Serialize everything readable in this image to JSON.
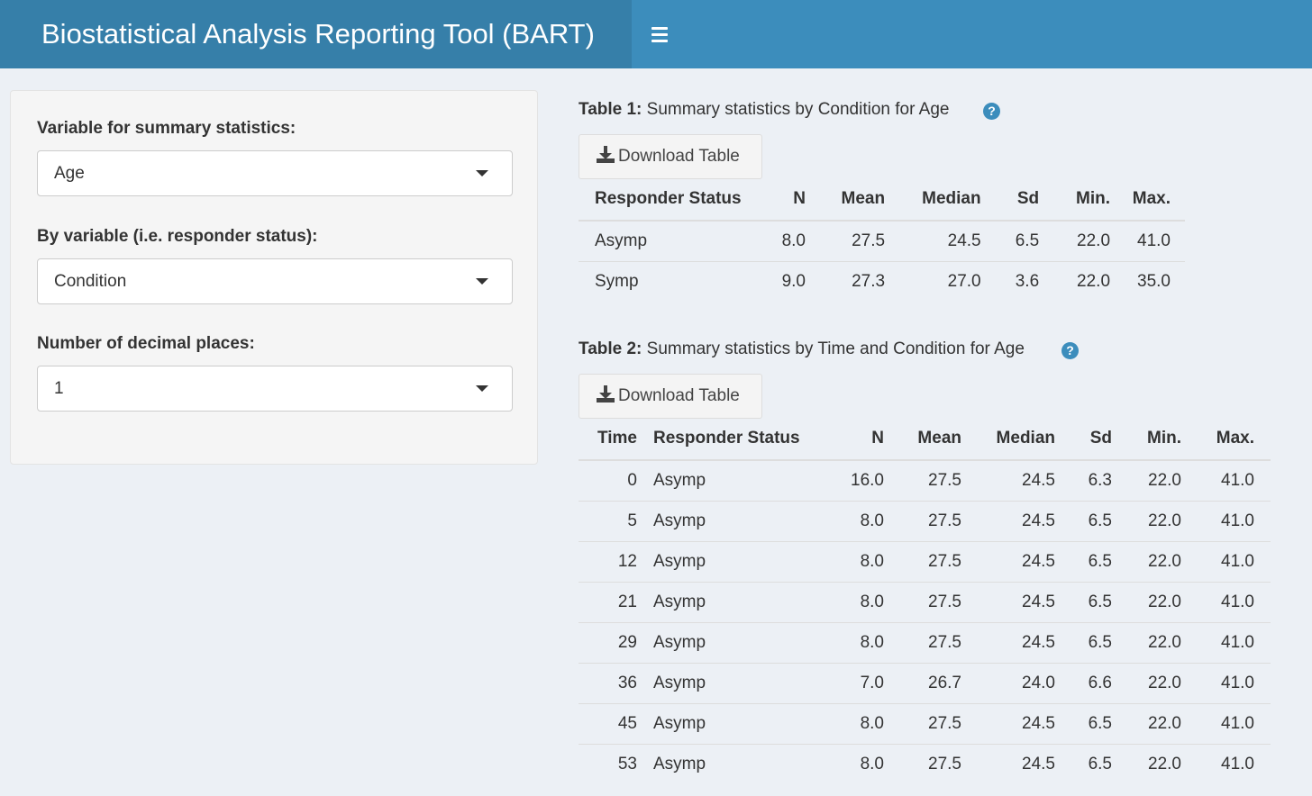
{
  "app": {
    "title": "Biostatistical Analysis Reporting Tool (BART)"
  },
  "sidebar": {
    "summary_var": {
      "label": "Variable for summary statistics:",
      "value": "Age"
    },
    "by_var": {
      "label": "By variable (i.e. responder status):",
      "value": "Condition"
    },
    "decimals": {
      "label": "Number of decimal places:",
      "value": "1"
    }
  },
  "table1": {
    "title_bold": "Table 1:",
    "title_rest": " Summary statistics by Condition for Age",
    "help": "?",
    "download_label": "Download Table",
    "headers": [
      "Responder Status",
      "N",
      "Mean",
      "Median",
      "Sd",
      "Min.",
      "Max."
    ],
    "rows": [
      [
        "Asymp",
        "8.0",
        "27.5",
        "24.5",
        "6.5",
        "22.0",
        "41.0"
      ],
      [
        "Symp",
        "9.0",
        "27.3",
        "27.0",
        "3.6",
        "22.0",
        "35.0"
      ]
    ]
  },
  "table2": {
    "title_bold": "Table 2:",
    "title_rest": " Summary statistics by Time and Condition for Age",
    "help": "?",
    "download_label": "Download Table",
    "headers": [
      "Time",
      "Responder Status",
      "N",
      "Mean",
      "Median",
      "Sd",
      "Min.",
      "Max."
    ],
    "rows": [
      [
        "0",
        "Asymp",
        "16.0",
        "27.5",
        "24.5",
        "6.3",
        "22.0",
        "41.0"
      ],
      [
        "5",
        "Asymp",
        "8.0",
        "27.5",
        "24.5",
        "6.5",
        "22.0",
        "41.0"
      ],
      [
        "12",
        "Asymp",
        "8.0",
        "27.5",
        "24.5",
        "6.5",
        "22.0",
        "41.0"
      ],
      [
        "21",
        "Asymp",
        "8.0",
        "27.5",
        "24.5",
        "6.5",
        "22.0",
        "41.0"
      ],
      [
        "29",
        "Asymp",
        "8.0",
        "27.5",
        "24.5",
        "6.5",
        "22.0",
        "41.0"
      ],
      [
        "36",
        "Asymp",
        "7.0",
        "26.7",
        "24.0",
        "6.6",
        "22.0",
        "41.0"
      ],
      [
        "45",
        "Asymp",
        "8.0",
        "27.5",
        "24.5",
        "6.5",
        "22.0",
        "41.0"
      ],
      [
        "53",
        "Asymp",
        "8.0",
        "27.5",
        "24.5",
        "6.5",
        "22.0",
        "41.0"
      ]
    ]
  },
  "colors": {
    "header": "#3c8dbc",
    "logo_bg": "#367fa9",
    "body_bg": "#ecf0f5"
  }
}
